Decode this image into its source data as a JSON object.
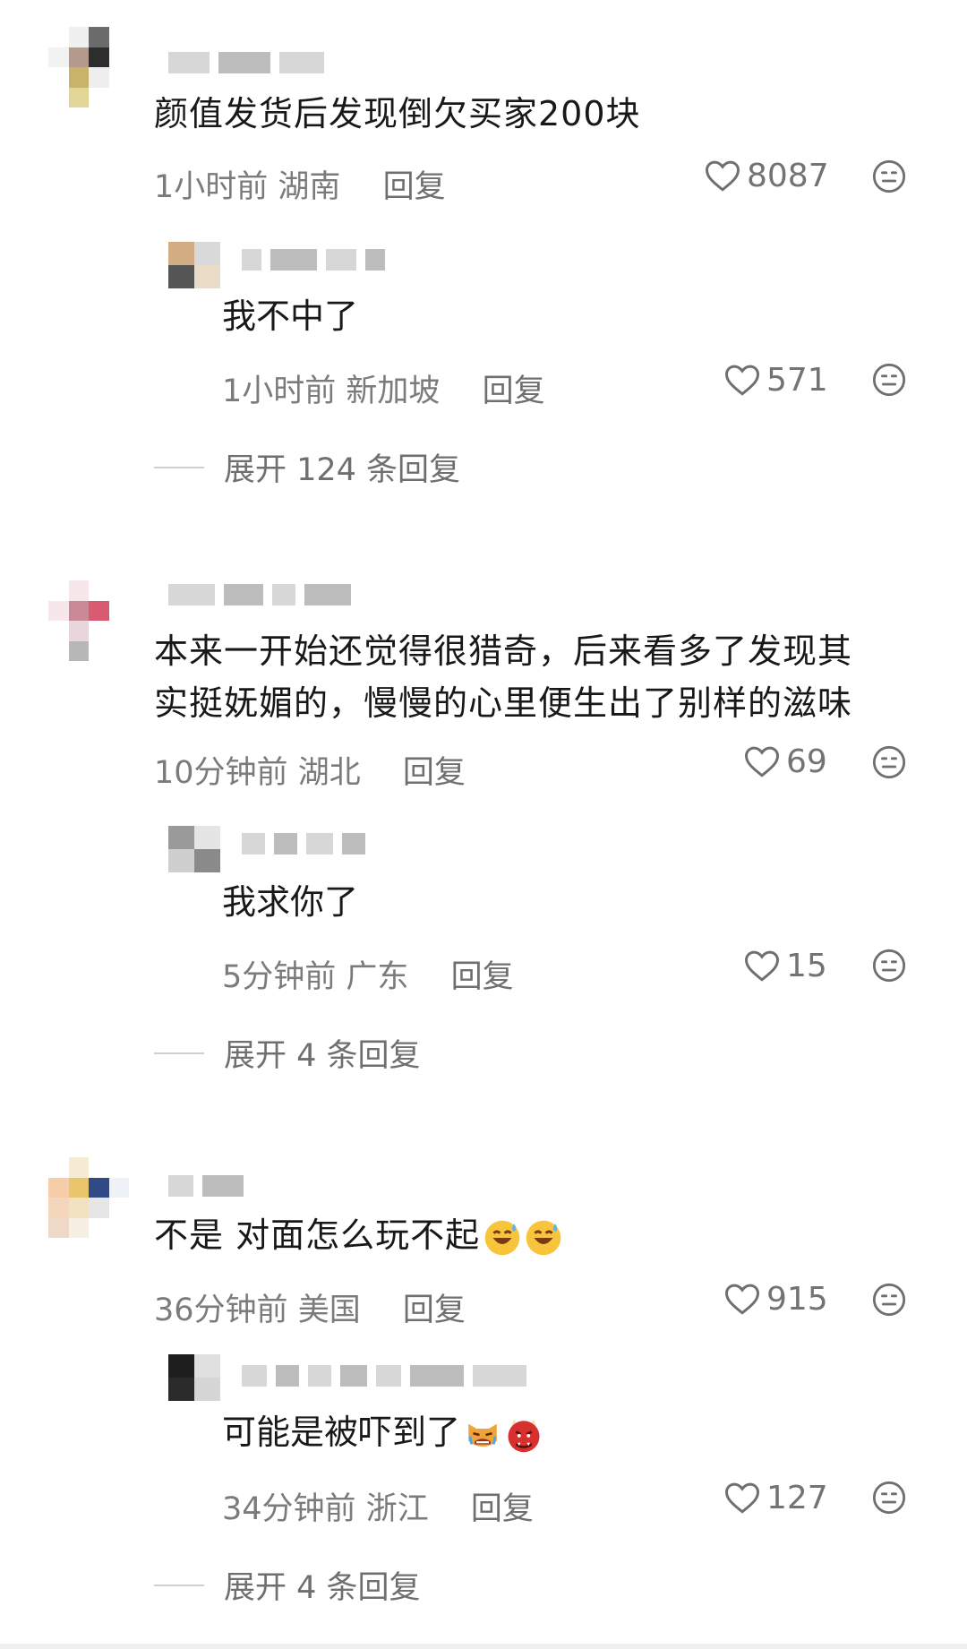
{
  "comments": [
    {
      "text": "颜值发货后发现倒欠买家200块",
      "time": "1小时前",
      "location": "湖南",
      "reply_label": "回复",
      "likes": "8087",
      "reply": {
        "text": "我不中了",
        "time": "1小时前",
        "location": "新加坡",
        "reply_label": "回复",
        "likes": "571"
      },
      "expand_label": "展开 124 条回复"
    },
    {
      "text_line1": "本来一开始还觉得很猎奇，后来看多了发现其",
      "text_line2": "实挺妩媚的，慢慢的心里便生出了别样的滋味",
      "time": "10分钟前",
      "location": "湖北",
      "reply_label": "回复",
      "likes": "69",
      "reply": {
        "text": "我求你了",
        "time": "5分钟前",
        "location": "广东",
        "reply_label": "回复",
        "likes": "15"
      },
      "expand_label": "展开 4 条回复"
    },
    {
      "text": "不是 对面怎么玩不起",
      "emoji_text": "😅😅",
      "time": "36分钟前",
      "location": "美国",
      "reply_label": "回复",
      "likes": "915",
      "reply": {
        "text": "可能是被吓到了",
        "emoji_text": "😿👹",
        "time": "34分钟前",
        "location": "浙江",
        "reply_label": "回复",
        "likes": "127"
      },
      "expand_label": "展开 4 条回复"
    }
  ],
  "icons": {
    "like": "heart-outline-icon",
    "dislike": "neutral-face-icon",
    "emoji_sweat": "grinning-sweat-emoji",
    "emoji_cat": "crying-cat-emoji",
    "emoji_ogre": "ogre-emoji"
  },
  "colors": {
    "text": "#181818",
    "meta": "#7b7b7b",
    "background": "#ffffff"
  }
}
